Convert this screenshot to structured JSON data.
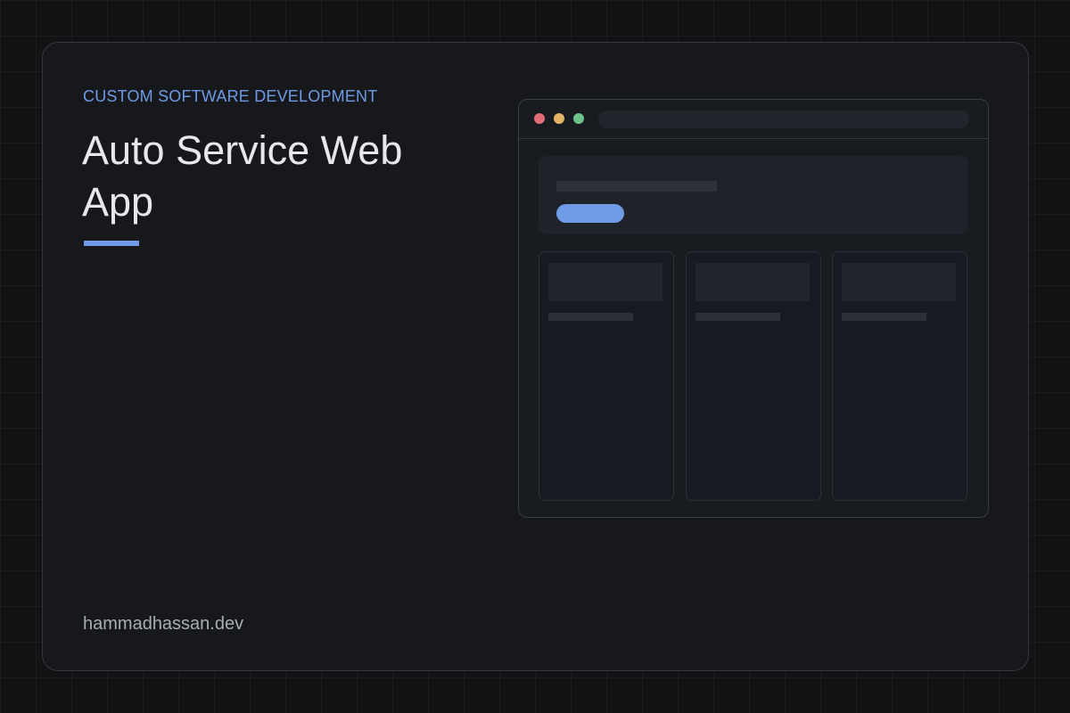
{
  "eyebrow": "CUSTOM SOFTWARE DEVELOPMENT",
  "title": "Auto Service Web App",
  "site": "hammadhassan.dev",
  "colors": {
    "accent": "#6f9ae6",
    "dot_red": "#e06c75",
    "dot_yellow": "#e5b567",
    "dot_green": "#6fc28b"
  },
  "mockup": {
    "window_controls": [
      "close-dot",
      "minimize-dot",
      "maximize-dot"
    ],
    "columns": 3
  }
}
